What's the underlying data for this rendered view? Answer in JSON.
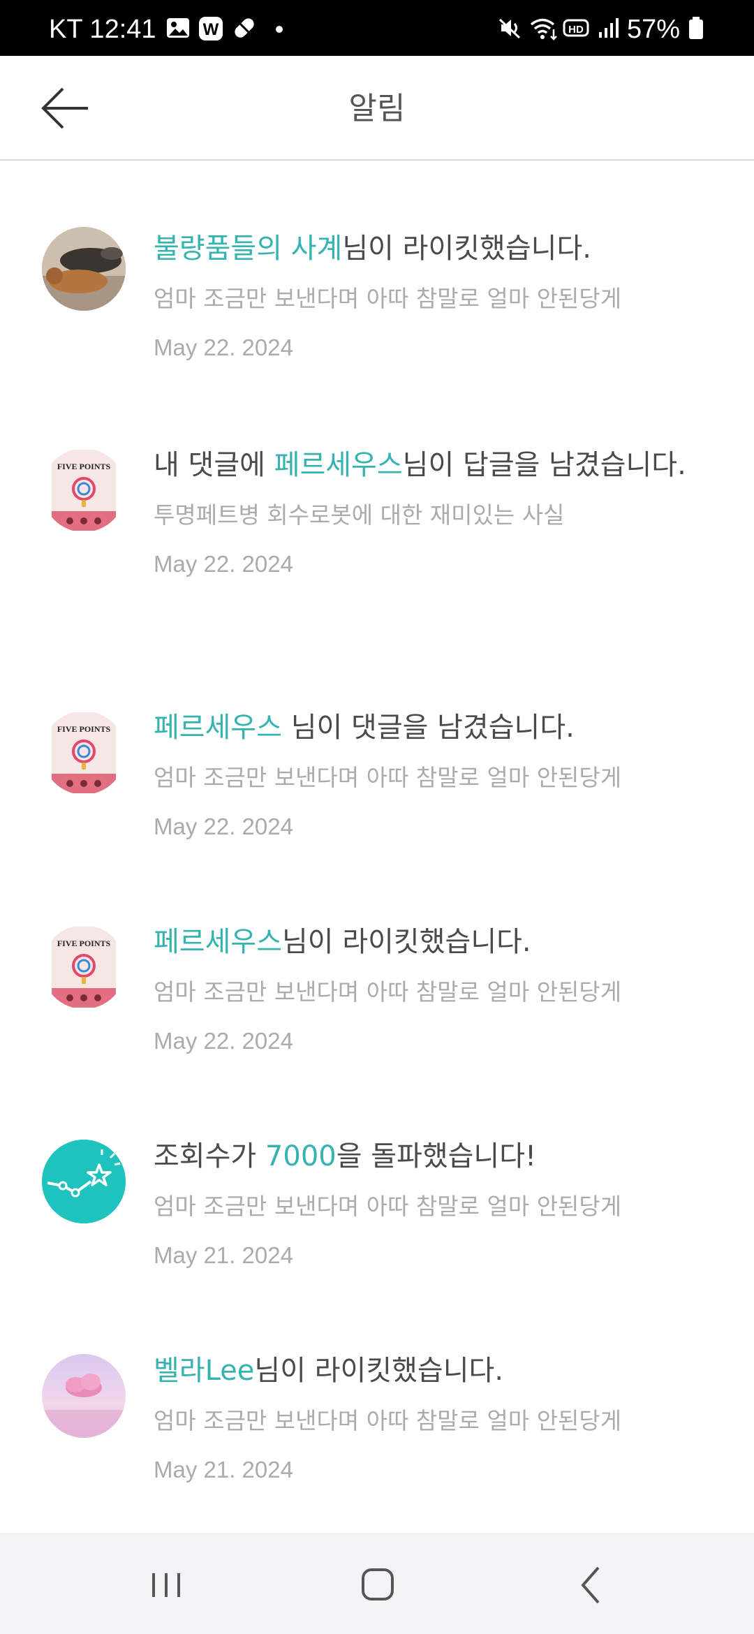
{
  "status_bar": {
    "time": "KT 12:41",
    "battery": "57%",
    "icons": [
      "gallery-icon",
      "w-app-icon",
      "pill-icon",
      "dot-icon",
      "mute-icon",
      "wifi-icon",
      "hd-icon",
      "signal-icon",
      "battery-icon"
    ]
  },
  "header": {
    "title": "알림",
    "back_icon": "arrow-left-icon"
  },
  "colors": {
    "accent": "#34b3b0",
    "text": "#4a4a4a",
    "muted": "#ababab"
  },
  "notifications": [
    {
      "avatar": "dog-photo",
      "highlight": "불량품들의 사계",
      "before": "",
      "after": "님이 라이킷했습니다.",
      "sub": "엄마 조금만 보낸다며 아따 참말로 얼마 안된당게",
      "date": "May 22. 2024"
    },
    {
      "avatar": "five-points-book-cover",
      "before": "내 댓글에 ",
      "highlight": "페르세우스",
      "after": "님이 답글을 남겼습니다.",
      "sub": "투명페트병 회수로봇에 대한 재미있는 사실",
      "date": "May 22. 2024"
    },
    {
      "avatar": "five-points-book-cover",
      "before": "",
      "highlight": "페르세우스",
      "after": " 님이 댓글을 남겼습니다.",
      "sub": "엄마 조금만 보낸다며 아따 참말로 얼마 안된당게",
      "date": "May 22. 2024"
    },
    {
      "avatar": "five-points-book-cover",
      "before": "",
      "highlight": "페르세우스",
      "after": "님이 라이킷했습니다.",
      "sub": "엄마 조금만 보낸다며 아따 참말로 얼마 안된당게",
      "date": "May 22. 2024"
    },
    {
      "avatar": "stats-star-icon",
      "before": "조회수가 ",
      "highlight": "7000",
      "after": "을 돌파했습니다!",
      "sub": "엄마 조금만 보낸다며 아따 참말로 얼마 안된당게",
      "date": "May 21. 2024"
    },
    {
      "avatar": "pink-cloud-photo",
      "before": "",
      "highlight": "벨라Lee",
      "after": "님이 라이킷했습니다.",
      "sub": "엄마 조금만 보낸다며 아따 참말로 얼마 안된당게",
      "date": "May 21. 2024"
    }
  ],
  "book_cover_title": "FIVE POINTS",
  "nav_bar": {
    "recent_icon": "recent-apps-icon",
    "home_icon": "home-icon",
    "back_icon": "nav-back-icon"
  }
}
